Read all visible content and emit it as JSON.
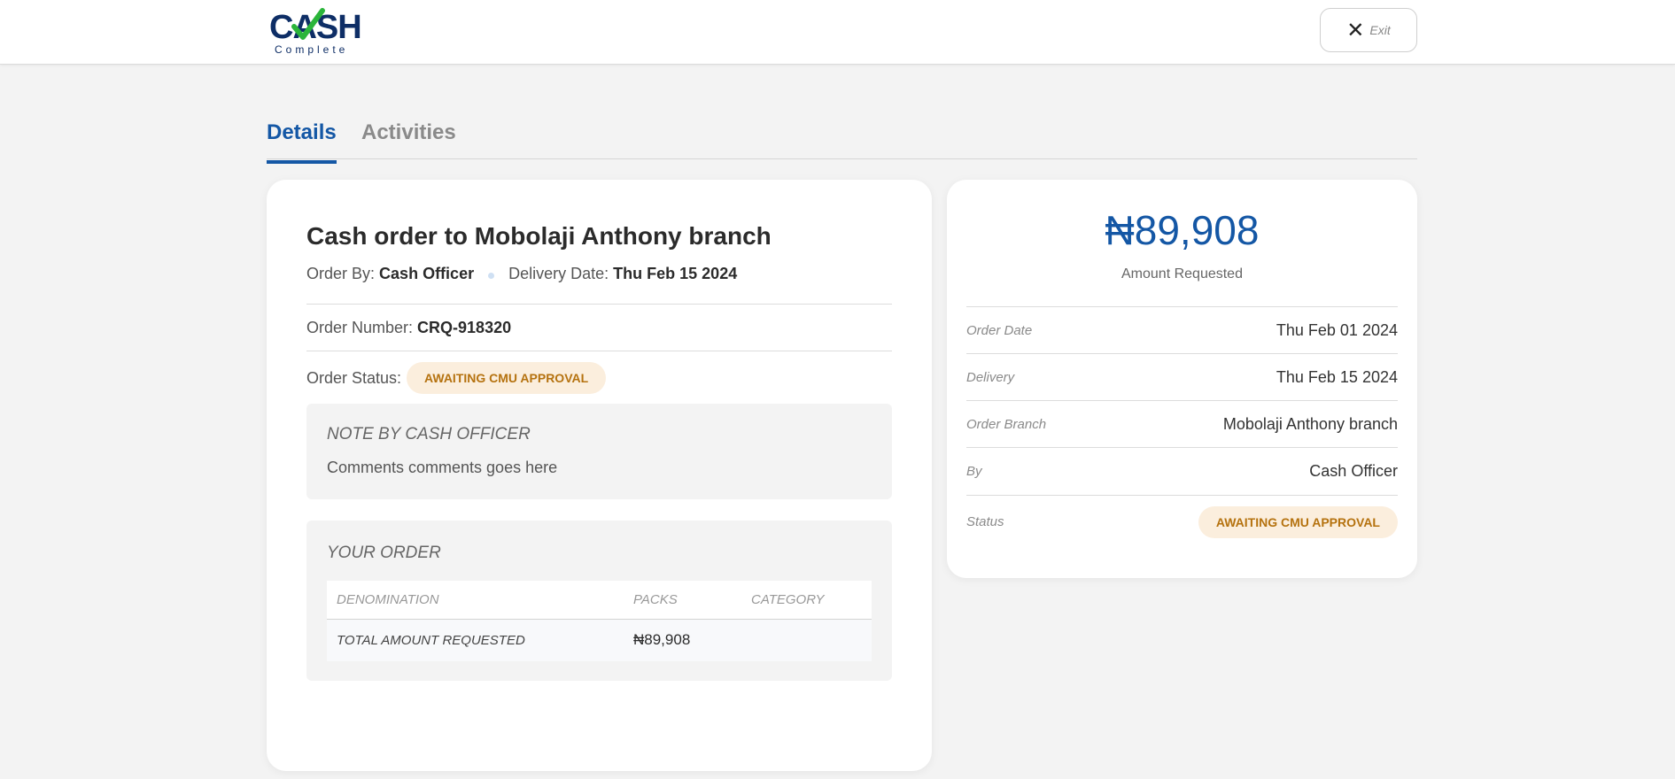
{
  "brand": {
    "logo_main": "CASH",
    "logo_sub": "Complete"
  },
  "header": {
    "exit_label": "Exit"
  },
  "tabs": [
    {
      "label": "Details",
      "active": true
    },
    {
      "label": "Activities",
      "active": false
    }
  ],
  "order": {
    "title": "Cash order to Mobolaji Anthony branch",
    "order_by_label": "Order By:",
    "order_by": "Cash Officer",
    "delivery_date_label": "Delivery Date:",
    "delivery_date": "Thu Feb 15 2024",
    "order_number_label": "Order Number:",
    "order_number": "CRQ-918320",
    "order_status_label": "Order Status:",
    "order_status": "AWAITING CMU APPROVAL",
    "note_title": "NOTE BY CASH OFFICER",
    "note_text": "Comments comments goes here",
    "your_order_title": "YOUR ORDER",
    "table": {
      "headers": [
        "DENOMINATION",
        "PACKS",
        "CATEGORY"
      ],
      "total_label": "TOTAL AMOUNT REQUESTED",
      "total_value": "₦89,908"
    }
  },
  "summary": {
    "amount": "₦89,908",
    "amount_label": "Amount Requested",
    "rows": [
      {
        "key": "Order Date",
        "value": "Thu Feb 01 2024"
      },
      {
        "key": "Delivery",
        "value": "Thu Feb 15 2024"
      },
      {
        "key": "Order Branch",
        "value": "Mobolaji Anthony branch"
      },
      {
        "key": "By",
        "value": "Cash Officer"
      },
      {
        "key": "Status",
        "value": "AWAITING CMU APPROVAL"
      }
    ]
  },
  "colors": {
    "accent": "#1457a5",
    "badge_bg": "#fbeedd",
    "badge_text": "#b5720f",
    "logo_check": "#2bb53a",
    "logo_navy": "#0e2e66"
  }
}
